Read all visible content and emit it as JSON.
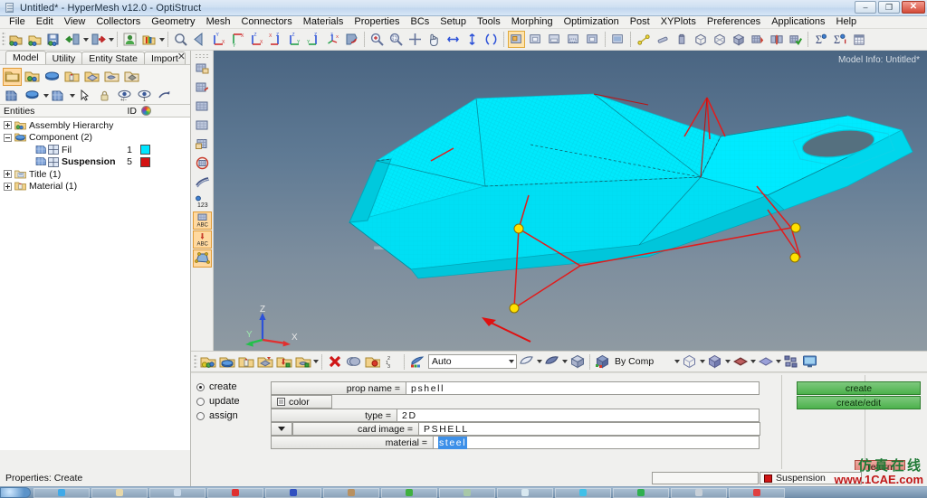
{
  "window": {
    "title": "Untitled* - HyperMesh v12.0 - OptiStruct",
    "app_icon": "document-icon",
    "minimize_glyph": "–",
    "restore_glyph": "❐",
    "close_glyph": "✕"
  },
  "menu": {
    "items": [
      {
        "label": "File"
      },
      {
        "label": "Edit"
      },
      {
        "label": "View"
      },
      {
        "label": "Collectors"
      },
      {
        "label": "Geometry"
      },
      {
        "label": "Mesh"
      },
      {
        "label": "Connectors"
      },
      {
        "label": "Materials"
      },
      {
        "label": "Properties"
      },
      {
        "label": "BCs"
      },
      {
        "label": "Setup"
      },
      {
        "label": "Tools"
      },
      {
        "label": "Morphing"
      },
      {
        "label": "Optimization"
      },
      {
        "label": "Post"
      },
      {
        "label": "XYPlots"
      },
      {
        "label": "Preferences"
      },
      {
        "label": "Applications"
      },
      {
        "label": "Help"
      }
    ]
  },
  "left_panel": {
    "tabs": [
      {
        "label": "Model",
        "active": true
      },
      {
        "label": "Utility",
        "active": false
      },
      {
        "label": "Entity State",
        "active": false
      },
      {
        "label": "Import",
        "active": false
      }
    ],
    "close_glyph": "✕",
    "tree_header": {
      "entities": "Entities",
      "id": "ID",
      "color_icon": "color-wheel-icon"
    },
    "tree": [
      {
        "label": "Assembly Hierarchy",
        "indent": 0,
        "expander": "plus",
        "icon": "assembly-icon",
        "id": "",
        "color": "",
        "bold": false
      },
      {
        "label": "Component (2)",
        "indent": 0,
        "expander": "minus",
        "icon": "component-folder-icon",
        "id": "",
        "color": "",
        "bold": false
      },
      {
        "label": "Fil",
        "indent": 2,
        "expander": "none",
        "icon": "component-icon",
        "id": "1",
        "color": "#00e5ff",
        "bold": false
      },
      {
        "label": "Suspension",
        "indent": 2,
        "expander": "none",
        "icon": "component-icon",
        "id": "5",
        "color": "#d41111",
        "bold": true
      },
      {
        "label": "Title (1)",
        "indent": 0,
        "expander": "plus",
        "icon": "title-icon",
        "id": "",
        "color": "",
        "bold": false
      },
      {
        "label": "Material (1)",
        "indent": 0,
        "expander": "plus",
        "icon": "material-icon",
        "id": "",
        "color": "",
        "bold": false
      }
    ],
    "status": "Properties: Create"
  },
  "viewport": {
    "model_info": "Model Info: Untitled*",
    "watermark": "1CAE.COM",
    "triad": {
      "x_label": "X",
      "y_label": "Y",
      "z_label": "Z",
      "x_color": "#e03030",
      "y_color": "#22c04a",
      "z_color": "#2d52d8"
    },
    "mesh_color": "#00eaff",
    "connector_color": "#e01a1a",
    "node_color": "#ffe000"
  },
  "panel_toolbar": {
    "mode_combo": {
      "value": "Auto",
      "icon": "auto-select-icon"
    },
    "bycomp_combo": {
      "value": "By Comp",
      "icon": "by-comp-icon"
    }
  },
  "panel_form": {
    "modes": [
      {
        "label": "create",
        "selected": true
      },
      {
        "label": "update",
        "selected": false
      },
      {
        "label": "assign",
        "selected": false
      }
    ],
    "fields": [
      {
        "label": "prop name =",
        "value": "pshell",
        "highlight": false
      },
      {
        "label": "type =",
        "value": "2D",
        "highlight": false
      },
      {
        "label": "card image =",
        "value": "PSHELL",
        "highlight": false
      },
      {
        "label": "material =",
        "value": "steel",
        "highlight": true
      }
    ],
    "color_button": "color",
    "dropdown_icon": "chevron-down-icon",
    "actions": [
      {
        "label": "create"
      },
      {
        "label": "create/edit"
      }
    ],
    "return_label": "return"
  },
  "status_bar": {
    "component": "Suspension",
    "component_color": "#d01616",
    "branding_cn": "仿真在线",
    "branding_url": "www.1CAE.com"
  }
}
